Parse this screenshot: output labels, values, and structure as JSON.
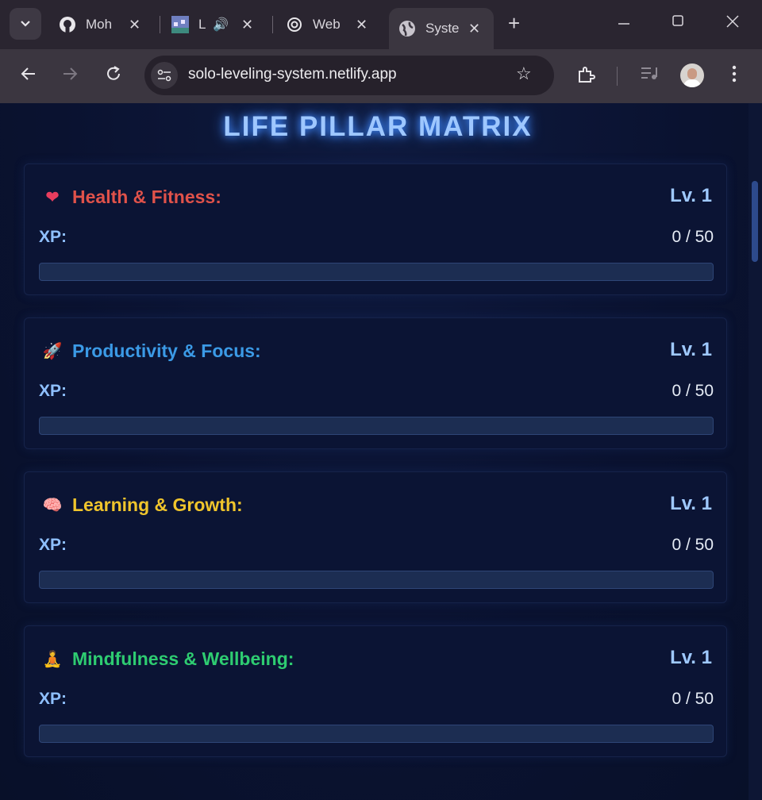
{
  "browser": {
    "tabs": [
      {
        "title": "Moh",
        "icon": "github-icon"
      },
      {
        "title": "L",
        "icon": "pixel-site-icon",
        "audio": true
      },
      {
        "title": "Web",
        "icon": "openai-icon"
      },
      {
        "title": "Syste",
        "icon": "globe-icon",
        "active": true
      }
    ],
    "url": "solo-leveling-system.netlify.app"
  },
  "page": {
    "title": "LIFE PILLAR MATRIX",
    "pillars": [
      {
        "emoji": "❤",
        "name": "Health & Fitness:",
        "color": "#e0524a",
        "level": "Lv. 1",
        "xp_label": "XP:",
        "xp": "0 / 50",
        "progress": 0
      },
      {
        "emoji": "🚀",
        "name": "Productivity & Focus:",
        "color": "#3b9ae6",
        "level": "Lv. 1",
        "xp_label": "XP:",
        "xp": "0 / 50",
        "progress": 0
      },
      {
        "emoji": "🧠",
        "name": "Learning & Growth:",
        "color": "#f0c52c",
        "level": "Lv. 1",
        "xp_label": "XP:",
        "xp": "0 / 50",
        "progress": 0
      },
      {
        "emoji": "🧘",
        "name": "Mindfulness & Wellbeing:",
        "color": "#2ecc71",
        "level": "Lv. 1",
        "xp_label": "XP:",
        "xp": "0 / 50",
        "progress": 0
      }
    ]
  }
}
